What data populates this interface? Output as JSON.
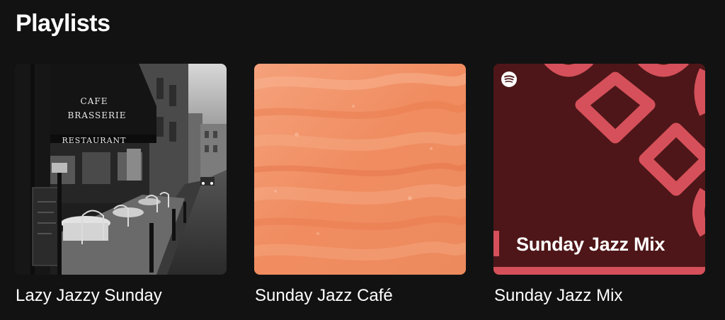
{
  "section": {
    "title": "Playlists"
  },
  "playlists": [
    {
      "title": "Lazy Jazzy Sunday",
      "cover": {
        "kind": "photo",
        "signs": [
          "CAFE",
          "BRASSERIE",
          "RESTAURANT"
        ],
        "palette": "grayscale"
      }
    },
    {
      "title": "Sunday Jazz Café",
      "cover": {
        "kind": "abstract-texture",
        "colors": [
          "#f08a5d",
          "#f6a57c",
          "#e87548"
        ]
      }
    },
    {
      "title": "Sunday Jazz Mix",
      "cover": {
        "kind": "mix-art",
        "label": "Sunday Jazz Mix",
        "icon": "spotify-logo-icon",
        "colors": [
          "#4e1618",
          "#d5505a"
        ]
      }
    }
  ]
}
